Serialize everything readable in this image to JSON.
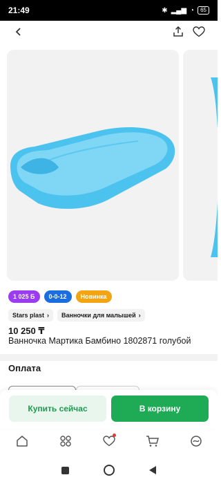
{
  "status_bar": {
    "time": "21:49",
    "battery": "65"
  },
  "header": {
    "back_icon": "chevron-left-icon",
    "share_icon": "share-icon",
    "favorite_icon": "heart-icon"
  },
  "badges": [
    {
      "label": "1 025 Б",
      "color": "#9b3cf0"
    },
    {
      "label": "0-0-12",
      "color": "#1a6ee0"
    },
    {
      "label": "Новинка",
      "color": "#f2a413"
    }
  ],
  "chips": [
    {
      "label": "Stars plast"
    },
    {
      "label": "Ванночки для малышей"
    }
  ],
  "product": {
    "price": "10 250 ₸",
    "title": "Ванночка Мартика Бамбино 1802871 голубой"
  },
  "payment": {
    "section_title": "Оплата"
  },
  "actions": {
    "buy_now": "Купить сейчас",
    "add_to_cart": "В корзину"
  },
  "colors": {
    "accent": "#1faa56",
    "product": "#4cc3ee"
  }
}
